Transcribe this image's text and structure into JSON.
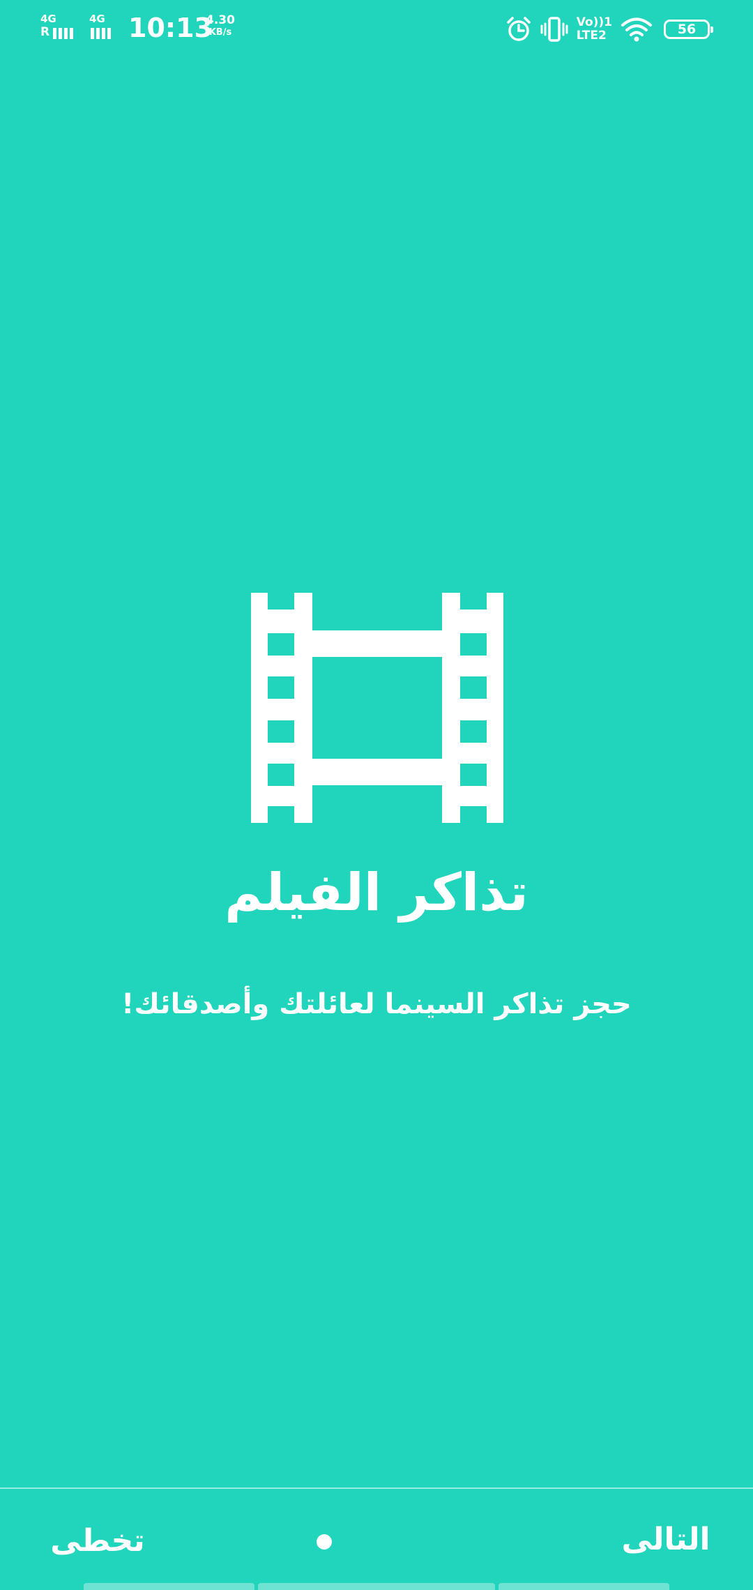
{
  "status_bar": {
    "sim1_network": "4G",
    "sim1_roaming": "R",
    "sim2_network": "4G",
    "time": "10:13",
    "net_speed_value": "4.30",
    "net_speed_unit": "KB/s",
    "volte_label": "Vo))1",
    "lte_label": "LTE2",
    "battery_level": "56",
    "icons": [
      "alarm-icon",
      "vibrate-icon",
      "volte-icon",
      "wifi-icon",
      "battery-icon"
    ]
  },
  "onboarding": {
    "icon": "film-strip-icon",
    "title": "تذاكر الفيلم",
    "subtitle": "حجز تذاكر السينما لعائلتك وأصدقائك!",
    "page_index": 1,
    "page_count": 1
  },
  "navigation": {
    "skip_label": "تخطى",
    "next_label": "التالى"
  },
  "colors": {
    "background": "#21D4BC",
    "foreground": "#FFFFFF"
  }
}
